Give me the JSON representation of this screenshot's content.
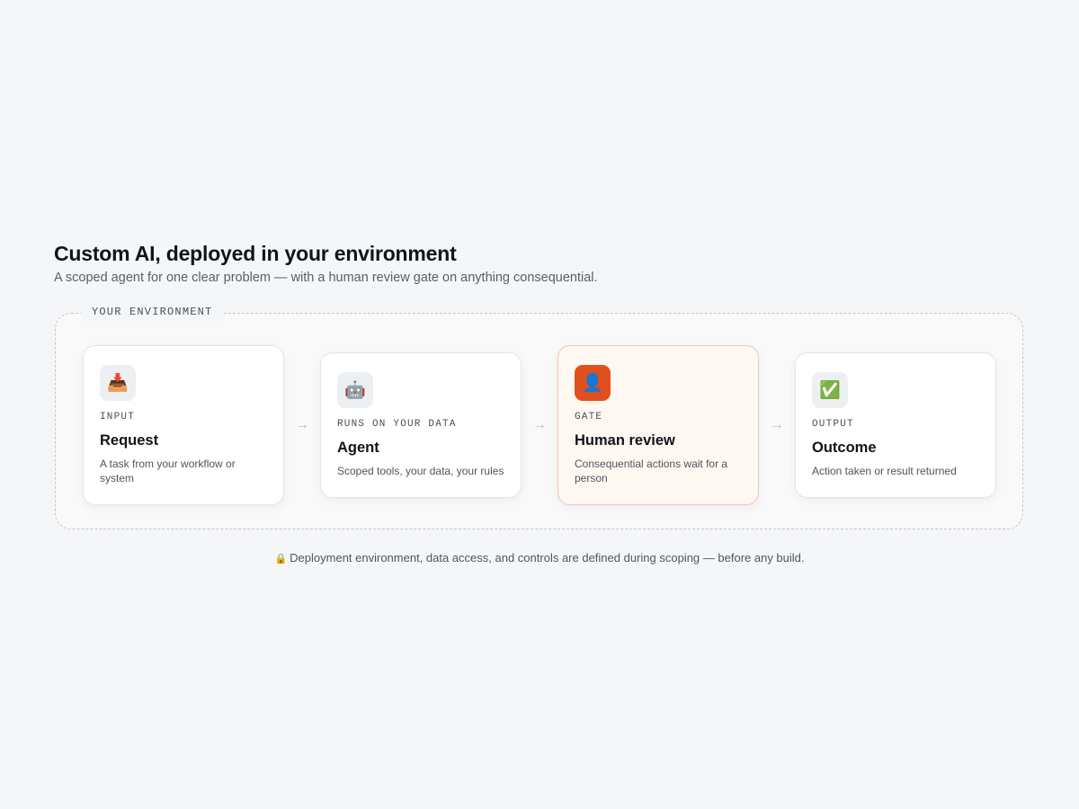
{
  "header": {
    "title": "Custom AI, deployed in your environment",
    "subtitle": "A scoped agent for one clear problem — with a human review gate on anything consequential."
  },
  "environment": {
    "label": "YOUR ENVIRONMENT"
  },
  "steps": [
    {
      "icon": "inbox-tray-icon",
      "icon_glyph": "📥",
      "eyebrow": "INPUT",
      "title": "Request",
      "description": "A task from your workflow or system"
    },
    {
      "icon": "robot-icon",
      "icon_glyph": "🤖",
      "eyebrow": "RUNS ON YOUR DATA",
      "title": "Agent",
      "description": "Scoped tools, your data, your rules"
    },
    {
      "icon": "person-icon",
      "icon_glyph": "👤",
      "eyebrow": "GATE",
      "title": "Human review",
      "description": "Consequential actions wait for a person"
    },
    {
      "icon": "check-mark-icon",
      "icon_glyph": "✅",
      "eyebrow": "OUTPUT",
      "title": "Outcome",
      "description": "Action taken or result returned"
    }
  ],
  "arrows": [
    "→",
    "→",
    "→"
  ],
  "footnote": {
    "icon": "lock-icon",
    "icon_glyph": "🔒",
    "text": "Deployment environment, data access, and controls are defined during scoping — before any build."
  },
  "colors": {
    "background": "#f5f6f8",
    "gate_accent": "#e0501c",
    "gate_card_background": "#fff7f2",
    "gate_card_border": "#f0c7b2"
  }
}
